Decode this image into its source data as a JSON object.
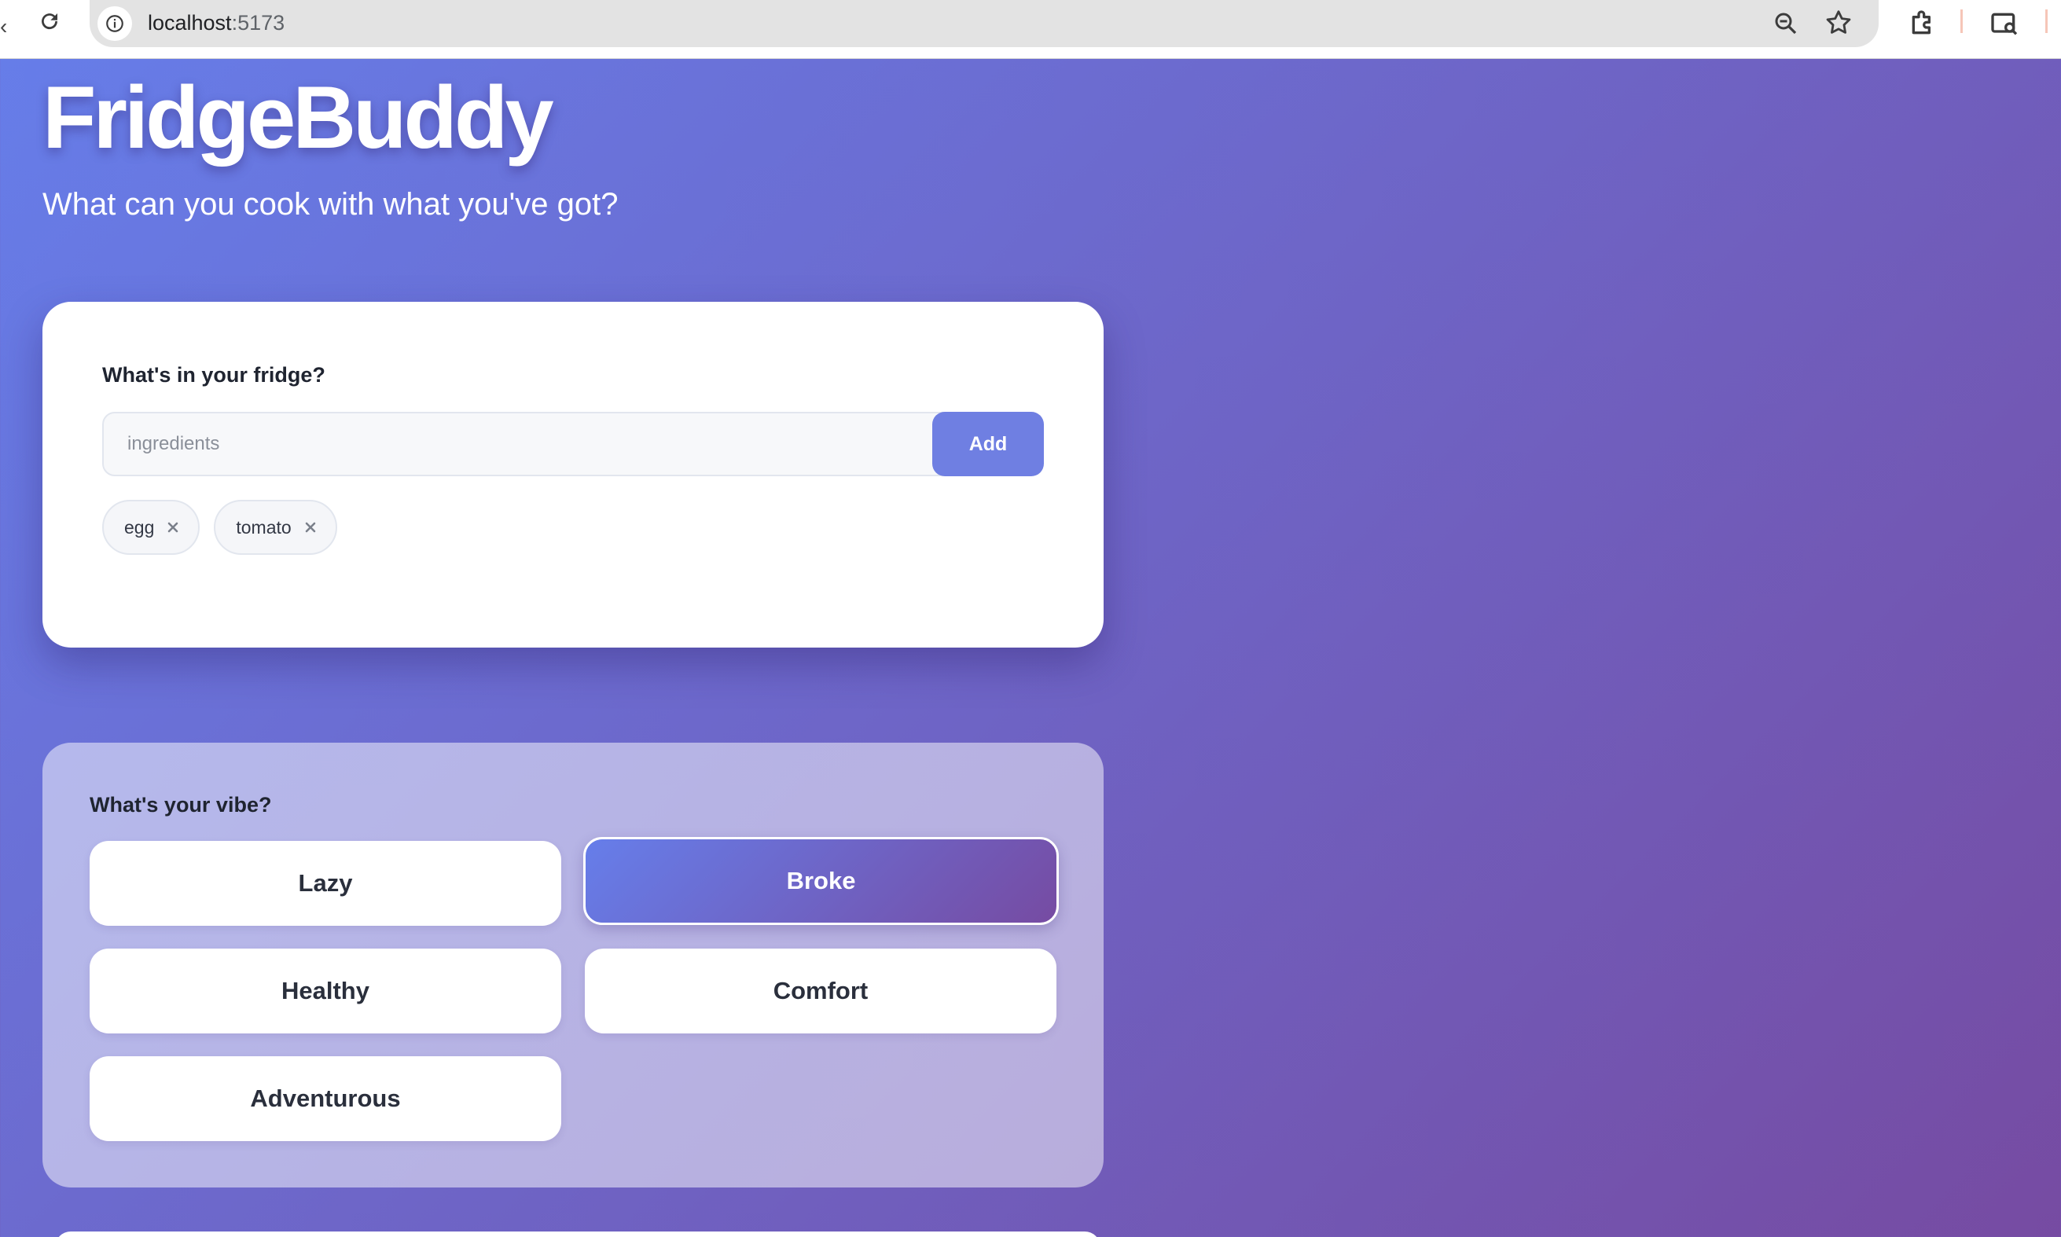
{
  "browser": {
    "url_host": "localhost",
    "url_port": ":5173",
    "icons": [
      "back-icon",
      "reload-icon",
      "site-info-icon",
      "zoom-icon",
      "bookmark-star-icon",
      "extensions-icon",
      "profile-icon"
    ]
  },
  "header": {
    "title": "FridgeBuddy",
    "subtitle": "What can you cook with what you've got?"
  },
  "fridge": {
    "label": "What's in your fridge?",
    "input_placeholder": "ingredients",
    "input_value": "",
    "add_label": "Add",
    "ingredients": [
      {
        "name": "egg"
      },
      {
        "name": "tomato"
      }
    ]
  },
  "vibe": {
    "label": "What's your vibe?",
    "options": [
      {
        "label": "Lazy",
        "selected": false
      },
      {
        "label": "Broke",
        "selected": true
      },
      {
        "label": "Healthy",
        "selected": false
      },
      {
        "label": "Comfort",
        "selected": false
      },
      {
        "label": "Adventurous",
        "selected": false
      }
    ]
  },
  "colors": {
    "gradient_start": "#667eea",
    "gradient_end": "#764ba2",
    "add_button": "#6f7fe2",
    "card_bg": "#ffffff"
  }
}
